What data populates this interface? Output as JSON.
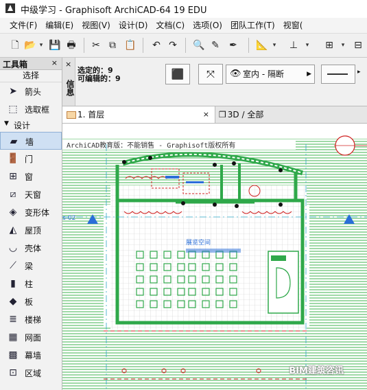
{
  "window": {
    "title": "中级学习 - Graphisoft ArchiCAD-64 19 EDU"
  },
  "menu": [
    "文件(F)",
    "编辑(E)",
    "视图(V)",
    "设计(D)",
    "文档(C)",
    "选项(O)",
    "团队工作(T)",
    "视窗("
  ],
  "toolbox": {
    "title": "工具箱",
    "close": "×",
    "select_label": "选择",
    "select_tools": [
      {
        "label": "箭头",
        "icon": "arrow-icon"
      },
      {
        "label": "选取框",
        "icon": "marquee-icon"
      }
    ],
    "design_section": "设计",
    "design_tools": [
      {
        "label": "墙",
        "icon": "wall-icon",
        "selected": true
      },
      {
        "label": "门",
        "icon": "door-icon"
      },
      {
        "label": "窗",
        "icon": "window-icon"
      },
      {
        "label": "天窗",
        "icon": "skylight-icon"
      },
      {
        "label": "变形体",
        "icon": "morph-icon"
      },
      {
        "label": "屋顶",
        "icon": "roof-icon"
      },
      {
        "label": "壳体",
        "icon": "shell-icon"
      },
      {
        "label": "梁",
        "icon": "beam-icon"
      },
      {
        "label": "柱",
        "icon": "column-icon"
      },
      {
        "label": "板",
        "icon": "slab-icon"
      },
      {
        "label": "楼梯",
        "icon": "stair-icon"
      },
      {
        "label": "网面",
        "icon": "mesh-icon"
      },
      {
        "label": "幕墙",
        "icon": "curtain-wall-icon"
      },
      {
        "label": "区域",
        "icon": "zone-icon"
      }
    ]
  },
  "infobox": {
    "strip_label": "信息",
    "close": "×",
    "selected_line": "选定的：9",
    "editable_line": "可编辑的：9",
    "view_setting": "室内 - 隔断"
  },
  "tabs": {
    "active": "1. 首层",
    "close": "×",
    "second": "3D / 全部"
  },
  "drawing": {
    "header_text": "ArchiCAD教育版：不能销售 - Graphisoft版权所有",
    "grid_marker_left": "s-02",
    "room_label": "展览空间",
    "watermark": "BIM建筑咨讯",
    "colors": {
      "wall": "#2fa84a",
      "grid_line": "#2ea8c8",
      "marker": "#2a6ed8",
      "hatch": "#3fb34f",
      "dim": "#d02020"
    }
  }
}
